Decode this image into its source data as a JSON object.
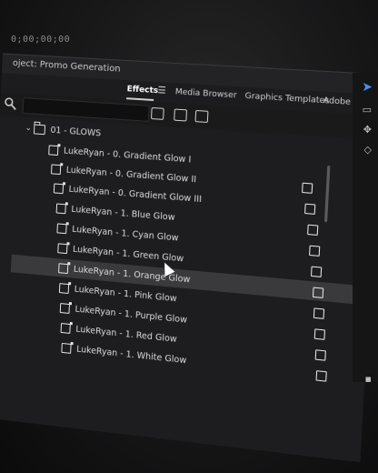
{
  "timecode": "0;00;00;00",
  "project": {
    "title": "oject: Promo Generation"
  },
  "tabs": [
    {
      "label": "Effects",
      "active": true
    },
    {
      "label": "Media Browser",
      "active": false
    },
    {
      "label": "Graphics Templates",
      "active": false
    },
    {
      "label": "Adobe",
      "active": false
    }
  ],
  "search": {
    "value": "",
    "placeholder": ""
  },
  "tree": {
    "folder": "01 - GLOWS",
    "items": [
      {
        "label": "LukeRyan - 0. Gradient Glow I",
        "badge": false
      },
      {
        "label": "LukeRyan - 0. Gradient Glow II",
        "badge": true
      },
      {
        "label": "LukeRyan - 0. Gradient Glow III",
        "badge": true
      },
      {
        "label": "LukeRyan - 1. Blue Glow",
        "badge": true
      },
      {
        "label": "LukeRyan - 1. Cyan Glow",
        "badge": true
      },
      {
        "label": "LukeRyan - 1. Green Glow",
        "badge": true
      },
      {
        "label": "LukeRyan - 1. Orange Glow",
        "badge": true,
        "highlighted": true
      },
      {
        "label": "LukeRyan - 1. Pink Glow",
        "badge": true
      },
      {
        "label": "LukeRyan - 1. Purple Glow",
        "badge": true
      },
      {
        "label": "LukeRyan - 1. Red Glow",
        "badge": true
      },
      {
        "label": "LukeRyan - 1. White Glow",
        "badge": true
      }
    ]
  },
  "colors": {
    "accent": "#4a8cf5",
    "highlight": "#3a3a3c"
  },
  "icons": [
    "search-icon",
    "menu-icon",
    "more-icon",
    "new-bin-icon",
    "new-preset-icon",
    "delete-icon",
    "selection-tool-icon",
    "folder-icon",
    "preset-icon"
  ]
}
